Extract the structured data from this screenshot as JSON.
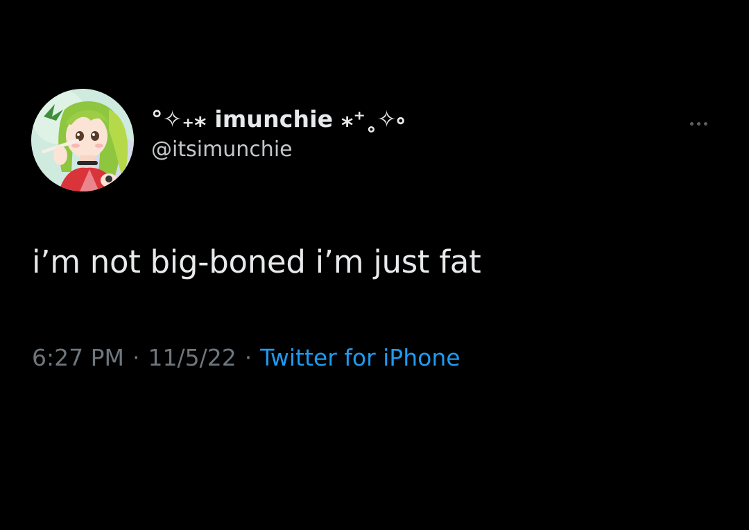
{
  "tweet": {
    "display_name": "°✧₊⁎ imunchie ⁎⁺˳✧༚",
    "handle": "@itsimunchie",
    "text": "i’m not big-boned i’m just fat",
    "time": "6:27 PM",
    "date": "11/5/22",
    "separator": "·",
    "source": "Twitter for iPhone"
  },
  "avatar": {
    "description_icon": "anime-girl-avatar-icon"
  },
  "more": {
    "icon": "more-dots-icon"
  },
  "colors": {
    "background": "#000000",
    "text_primary": "#e7e9ea",
    "text_secondary": "#6e767d",
    "handle": "#c4c7ca",
    "link": "#1d9bf0"
  }
}
